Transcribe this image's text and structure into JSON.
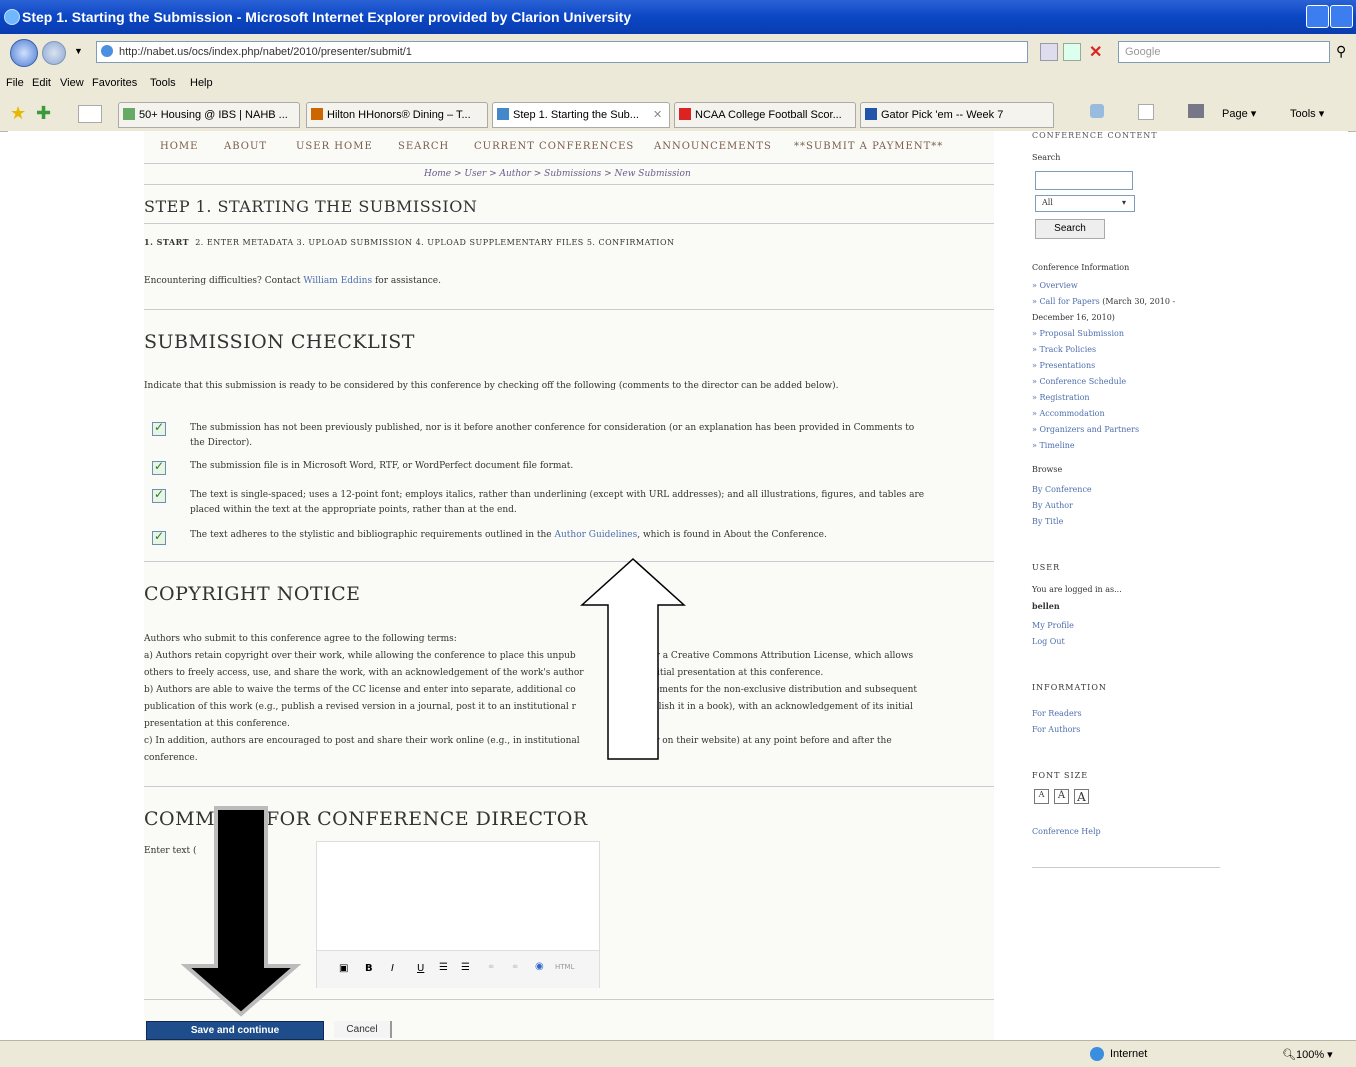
{
  "window": {
    "title": "Step 1. Starting the Submission - Microsoft Internet Explorer provided by Clarion University"
  },
  "address": {
    "url": "http://nabet.us/ocs/index.php/nabet/2010/presenter/submit/1",
    "search_placeholder": "Google"
  },
  "menu": [
    "File",
    "Edit",
    "View",
    "Favorites",
    "Tools",
    "Help"
  ],
  "tabs": [
    {
      "label": "50+ Housing @ IBS | NAHB ..."
    },
    {
      "label": "Hilton HHonors® Dining – T..."
    },
    {
      "label": "Step 1. Starting the Sub..."
    },
    {
      "label": "NCAA College Football Scor..."
    },
    {
      "label": "Gator Pick 'em -- Week 7"
    }
  ],
  "commandbar": {
    "page": "Page",
    "tools": "Tools"
  },
  "site_nav": [
    "HOME",
    "ABOUT",
    "USER HOME",
    "SEARCH",
    "CURRENT CONFERENCES",
    "ANNOUNCEMENTS",
    "**SUBMIT A PAYMENT**"
  ],
  "breadcrumb": "Home > User > Author > Submissions > New Submission",
  "step_title": "STEP 1. STARTING THE SUBMISSION",
  "steps": {
    "current": "1. START",
    "rest": "2. ENTER METADATA   3. UPLOAD SUBMISSION   4. UPLOAD SUPPLEMENTARY FILES   5. CONFIRMATION"
  },
  "difficulty": {
    "pre": "Encountering difficulties? Contact ",
    "contact": "William Eddins",
    "post": " for assistance."
  },
  "checklist": {
    "heading": "SUBMISSION CHECKLIST",
    "intro": "Indicate that this submission is ready to be considered by this conference by checking off the following (comments to the director can be added below).",
    "items": [
      {
        "line1": "The submission has not been previously published, nor is it before another conference for consideration (or an explanation has been provided in Comments to",
        "line2": "the Director)."
      },
      {
        "line1": "The submission file is in Microsoft Word, RTF, or WordPerfect document file format.",
        "line2": ""
      },
      {
        "line1": "The text is single-spaced; uses a 12-point font; employs italics, rather than underlining (except with URL addresses); and all illustrations, figures, and tables are",
        "line2": "placed within the text at the appropriate points, rather than at the end."
      },
      {
        "line1": "The text adheres to the stylistic and bibliographic requirements outlined in the ",
        "link": "Author Guidelines",
        "line1b": ", which is found in About the Conference.",
        "line2": ""
      }
    ]
  },
  "copyright": {
    "heading": "COPYRIGHT NOTICE",
    "lines": [
      "Authors who submit to this conference agree to the following terms:",
      "a) Authors retain copyright over their work, while allowing the conference to place this unpub                    under a Creative Commons Attribution License, which allows",
      "others to freely access, use, and share the work, with an acknowledgement of the work's author                    s initial presentation at this conference.",
      "b) Authors are able to waive the terms of the CC license and enter into separate, additional co                    rangements for the non-exclusive distribution and subsequent",
      "publication of this work (e.g., publish a revised version in a journal, post it to an institutional r                    e publish it in a book), with an acknowledgement of its initial",
      "presentation at this conference.",
      "c) In addition, authors are encouraged to post and share their work online (e.g., in institutional                    es or on their website) at any point before and after the",
      "conference."
    ]
  },
  "comments": {
    "heading_a": "COMM",
    "heading_b": "FOR CONFERENCE DIRECTOR",
    "label": "Enter text ("
  },
  "buttons": {
    "save": "Save and continue",
    "cancel": "Cancel"
  },
  "sidebar": {
    "conference_content": "CONFERENCE CONTENT",
    "search_label": "Search",
    "scope": "All",
    "search_button": "Search",
    "conf_info": "Conference Information",
    "info_links": [
      "» Overview",
      "» Call for Papers",
      "December 16, 2010)",
      "» Proposal Submission",
      "» Track Policies",
      "» Presentations",
      "» Conference Schedule",
      "» Registration",
      "» Accommodation",
      "» Organizers and Partners",
      "» Timeline"
    ],
    "cfp_dates": "(March 30, 2010 -",
    "browse": "Browse",
    "browse_links": [
      "By Conference",
      "By Author",
      "By Title"
    ],
    "user_heading": "USER",
    "logged_in": "You are logged in as...",
    "username": "bellen",
    "user_links": [
      "My Profile",
      "Log Out"
    ],
    "information_heading": "INFORMATION",
    "information_links": [
      "For Readers",
      "For Authors"
    ],
    "font_size_heading": "FONT SIZE",
    "font_sizes": [
      "A",
      "A",
      "A"
    ],
    "help": "Conference Help"
  },
  "status": {
    "zone": "Internet",
    "zoom": "100%"
  }
}
